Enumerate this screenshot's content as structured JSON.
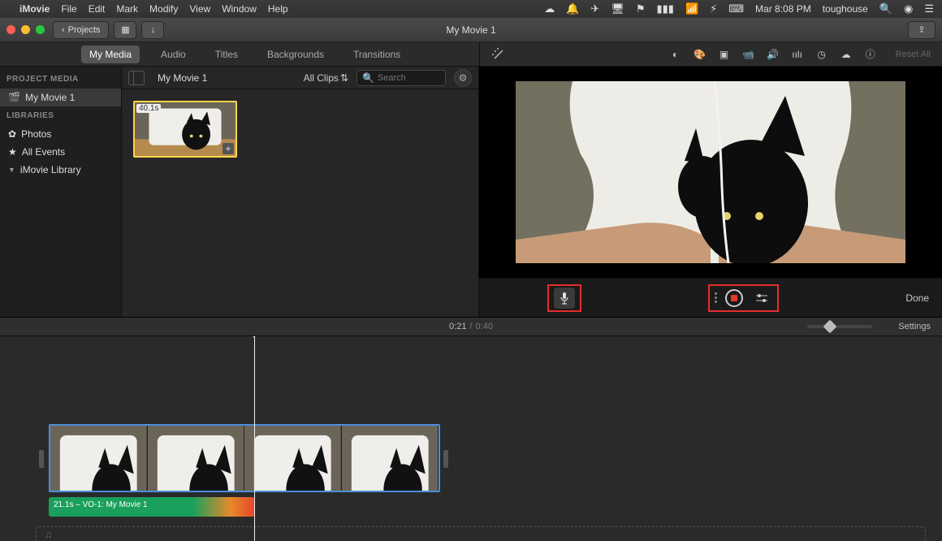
{
  "menubar": {
    "app": "iMovie",
    "items": [
      "File",
      "Edit",
      "Mark",
      "Modify",
      "View",
      "Window",
      "Help"
    ],
    "clock": "Mar 8:08 PM",
    "user": "toughouse"
  },
  "toolbar": {
    "projects_label": "Projects",
    "title": "My Movie 1"
  },
  "tabs": {
    "items": [
      "My Media",
      "Audio",
      "Titles",
      "Backgrounds",
      "Transitions"
    ],
    "active_index": 0,
    "reset_all": "Reset All"
  },
  "sidebar": {
    "section1": "PROJECT MEDIA",
    "project_item": "My Movie 1",
    "section2": "LIBRARIES",
    "lib_items": [
      "Photos",
      "All Events",
      "iMovie Library"
    ]
  },
  "browser": {
    "project_name": "My Movie 1",
    "filter_label": "All Clips",
    "search_placeholder": "Search",
    "clip_duration": "40.1s"
  },
  "viewer": {
    "done_label": "Done"
  },
  "timeline": {
    "current_time": "0:21",
    "total_time": "0:40",
    "settings_label": "Settings",
    "vo_label": "21.1s – VO-1: My Movie 1"
  }
}
